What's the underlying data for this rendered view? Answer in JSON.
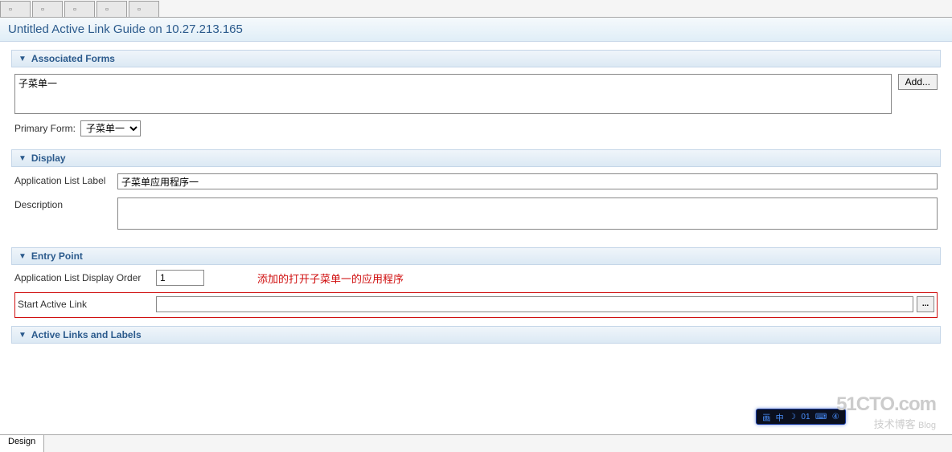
{
  "tabs": [
    {
      "label": ""
    },
    {
      "label": ""
    },
    {
      "label": ""
    },
    {
      "label": ""
    },
    {
      "label": ""
    }
  ],
  "page_title": "Untitled Active Link Guide on 10.27.213.165",
  "sections": {
    "associated_forms": {
      "title": "Associated Forms",
      "form_list_item": "子菜单一",
      "add_button": "Add...",
      "primary_form_label": "Primary Form:",
      "primary_form_value": "子菜单一"
    },
    "display": {
      "title": "Display",
      "app_label_label": "Application List Label",
      "app_label_value": "子菜单应用程序一",
      "description_label": "Description",
      "description_value": ""
    },
    "entry_point": {
      "title": "Entry Point",
      "display_order_label": "Application List Display Order",
      "display_order_value": "1",
      "annotation": "添加的打开子菜单一的应用程序",
      "start_link_label": "Start Active Link",
      "start_link_value": "",
      "browse_btn": "..."
    },
    "active_links": {
      "title": "Active Links and Labels"
    }
  },
  "bottom_tab": "Design",
  "watermark": {
    "line1": "51CTO.com",
    "line2a": "技术博客",
    "line2b": "Blog"
  },
  "taskbar": {
    "items": [
      "画",
      "中",
      "☽",
      "01",
      "⌨",
      "④"
    ]
  }
}
